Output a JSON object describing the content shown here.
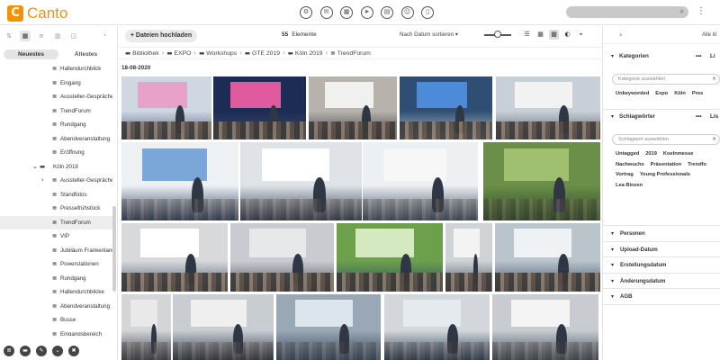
{
  "app": {
    "logo_text": "Canto",
    "logo_mark": "C"
  },
  "topbar": {
    "icons": [
      "gear-icon",
      "chat-icon",
      "collection-icon",
      "send-icon",
      "clipboard-icon",
      "smile-icon",
      "document-icon"
    ],
    "search_placeholder": ""
  },
  "sidebar": {
    "sort_newest": "Neuestes",
    "sort_oldest": "Ältestes",
    "tree": [
      {
        "label": "Hallendurchblick",
        "indent": 58
      },
      {
        "label": "Eingang",
        "indent": 58
      },
      {
        "label": "Aussteller-Gespräche",
        "indent": 58
      },
      {
        "label": "TrendForum",
        "indent": 58
      },
      {
        "label": "Rundgang",
        "indent": 58
      },
      {
        "label": "Abendveranstaltung",
        "indent": 58
      },
      {
        "label": "Eröffnung",
        "indent": 58
      },
      {
        "label": "Köln 2019",
        "indent": 50,
        "folder": true,
        "expanded": true
      },
      {
        "label": "Aussteller-Gespräche",
        "indent": 58,
        "collapsed": true
      },
      {
        "label": "Standfotos",
        "indent": 58
      },
      {
        "label": "Pressefrühstück",
        "indent": 58
      },
      {
        "label": "TrendForum",
        "indent": 58,
        "selected": true
      },
      {
        "label": "VIP",
        "indent": 58
      },
      {
        "label": "Jubiläum Frankenland",
        "indent": 58
      },
      {
        "label": "Powerstationen",
        "indent": 58
      },
      {
        "label": "Rundgang",
        "indent": 58
      },
      {
        "label": "Hallendurchblicke",
        "indent": 58
      },
      {
        "label": "Abendveranstaltung",
        "indent": 58
      },
      {
        "label": "Busse",
        "indent": 58
      },
      {
        "label": "Eingangsbereich",
        "indent": 58
      }
    ]
  },
  "main": {
    "upload_label": "+ Dateien hochladen",
    "element_count": "55",
    "element_label": "Elemente",
    "sort_label": "Nach Datum sortieren ▾",
    "breadcrumb": [
      "Bibliothek",
      "EXPO",
      "Workshops",
      "GTE 2019",
      "Köln 2019",
      "TrendForum"
    ],
    "date_group": "18-08-2020"
  },
  "rpanel": {
    "alle_label": "Alle lö",
    "kategorien": {
      "title": "Kategorien",
      "dots": "•••",
      "li": "Li",
      "placeholder": "Kategorie auswählen",
      "tags": [
        "Unkeyworded",
        "Expo",
        "Köln",
        "Pres"
      ]
    },
    "schlagwoerter": {
      "title": "Schlagwörter",
      "dots": "•••",
      "li": "Lis",
      "placeholder": "Schlagwort auswählen",
      "tags_row1": [
        "Untagged",
        "2019",
        "Koelnmesse"
      ],
      "tags_row2": [
        "Nachwuchs",
        "Präsentation",
        "Trendfo"
      ],
      "tags_row3": [
        "Vortrag",
        "Young Professionals"
      ],
      "tags_row4": [
        "Lea Binzen"
      ]
    },
    "sections": [
      "Personen",
      "Upload-Datum",
      "Erstellungsdatum",
      "Änderungsdatum",
      "AGB"
    ]
  }
}
